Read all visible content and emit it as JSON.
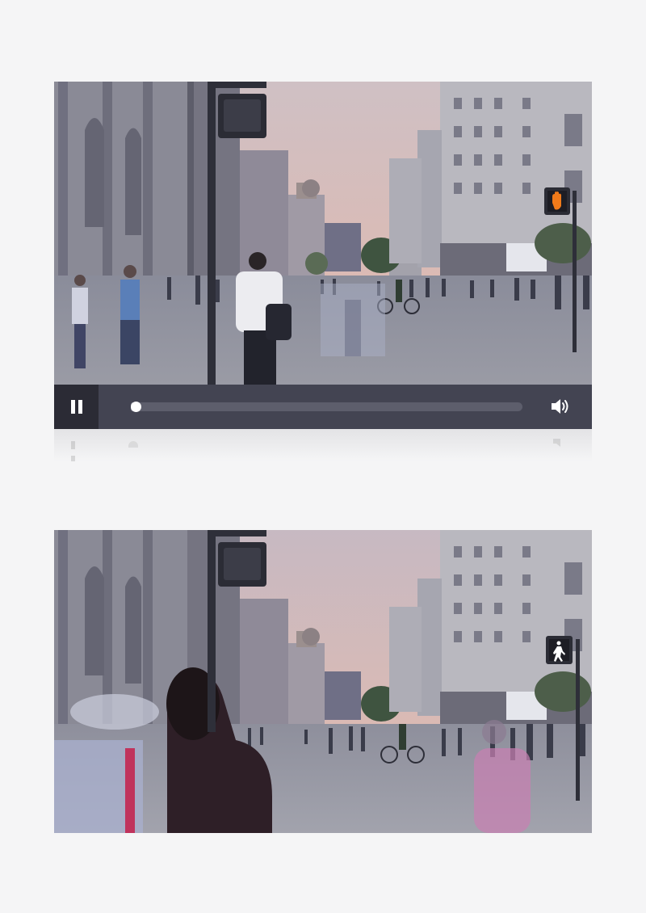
{
  "player": {
    "progress_fraction": 0.0,
    "pause_icon": "pause-icon",
    "volume_icon": "volume-icon"
  },
  "colors": {
    "control_bar": "#434452",
    "pause_background": "#2b2b35",
    "sky_dusk": "#d9b8b4",
    "walk_signal_hand": "#f07a1a",
    "walk_signal_pedestrian": "#ffffff"
  },
  "frames": [
    {
      "description": "video-frame-1",
      "signal": "orange-hand"
    },
    {
      "description": "video-frame-2",
      "signal": "white-walking-person"
    }
  ]
}
